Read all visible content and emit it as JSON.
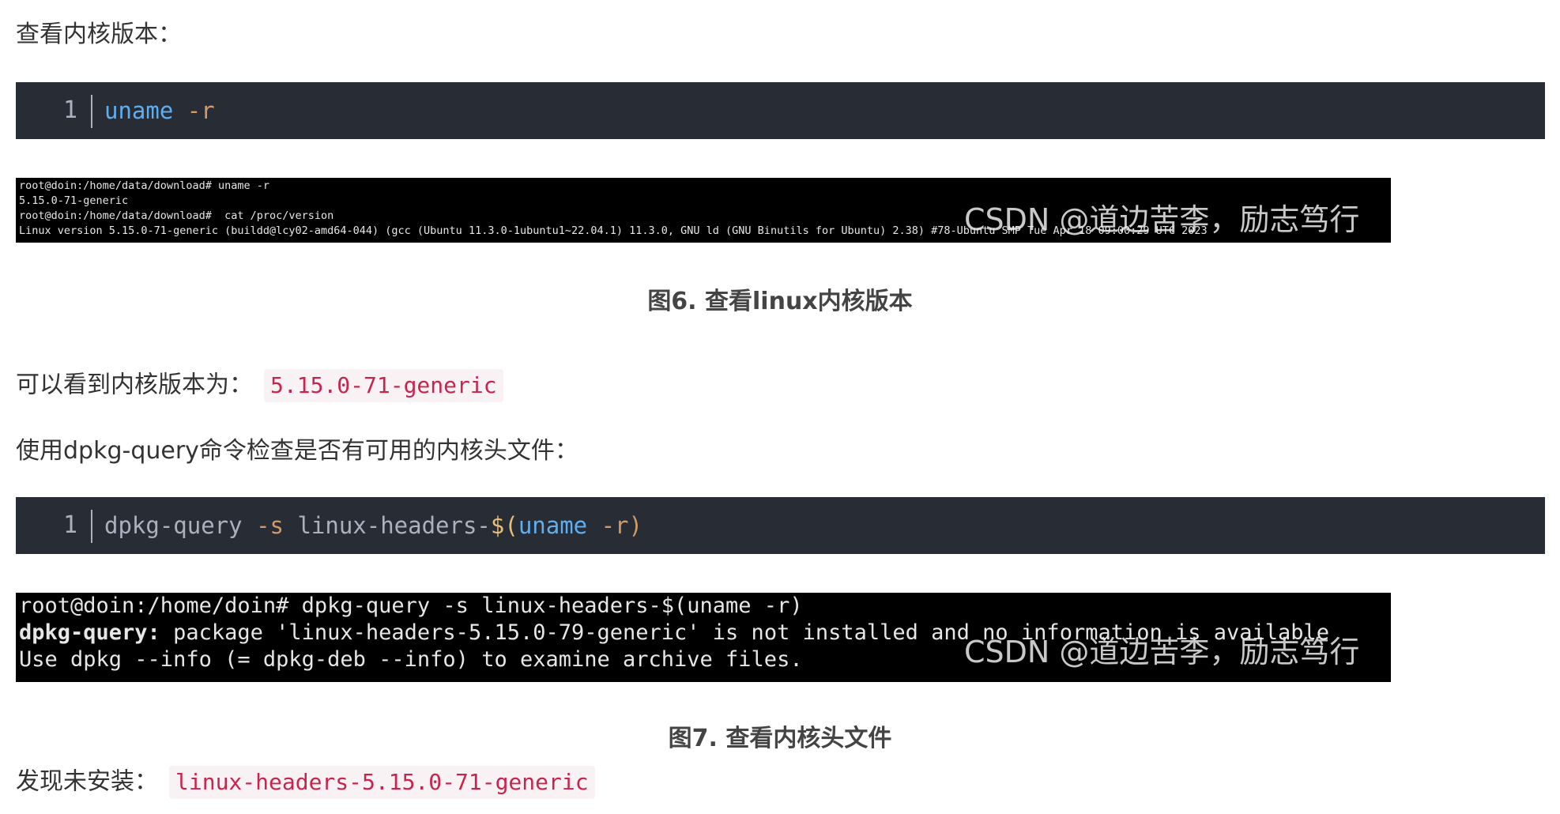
{
  "para_check_kernel": "查看内核版本：",
  "code1": {
    "line_no": "1",
    "cmd": "uname",
    "arg": " -r"
  },
  "terminal1": {
    "lines": [
      "root@doin:/home/data/download# uname -r",
      "5.15.0-71-generic",
      "root@doin:/home/data/download#  cat /proc/version",
      "Linux version 5.15.0-71-generic (buildd@lcy02-amd64-044) (gcc (Ubuntu 11.3.0-1ubuntu1~22.04.1) 11.3.0, GNU ld (GNU Binutils for Ubuntu) 2.38) #78-Ubuntu SMP Tue Apr 18 09:00:29 UTC 2023"
    ],
    "watermark": "CSDN @道边苦李，励志笃行"
  },
  "caption1": "图6. 查看linux内核版本",
  "para_version": {
    "text": "可以看到内核版本为：",
    "code": "5.15.0-71-generic"
  },
  "para_dpkg": "使用dpkg-query命令检查是否有可用的内核头文件：",
  "code2": {
    "line_no": "1",
    "part1": "dpkg-query",
    "part2": " -s",
    "part3": " linux-headers-",
    "part4": "$(",
    "part5": "uname",
    "part6": " -r)"
  },
  "terminal2": {
    "line1": "root@doin:/home/doin# dpkg-query -s linux-headers-$(uname -r)",
    "line2_bold": "dpkg-query:",
    "line2_rest": " package 'linux-headers-5.15.0-79-generic' is not installed and no information is available",
    "line3": "Use dpkg --info (= dpkg-deb --info) to examine archive files.",
    "watermark": "CSDN @道边苦李，励志笃行"
  },
  "caption2": "图7. 查看内核头文件",
  "para_not_installed": {
    "text": "发现未安装：",
    "code": "linux-headers-5.15.0-71-generic"
  }
}
